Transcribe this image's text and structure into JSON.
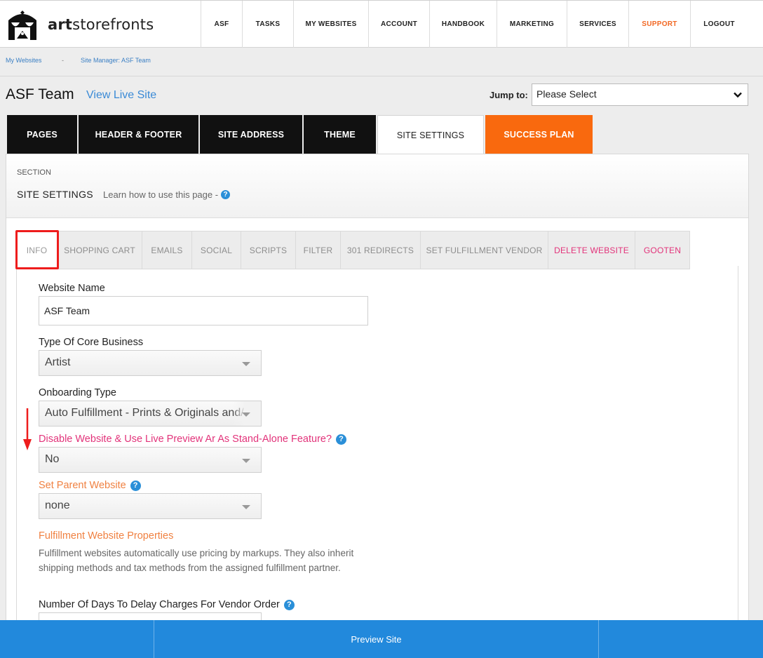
{
  "brand": {
    "name_bold": "art",
    "name_rest": "storefronts"
  },
  "nav": {
    "items": [
      {
        "label": "ASF"
      },
      {
        "label": "TASKS"
      },
      {
        "label": "MY WEBSITES"
      },
      {
        "label": "ACCOUNT"
      },
      {
        "label": "HANDBOOK"
      },
      {
        "label": "MARKETING"
      },
      {
        "label": "SERVICES"
      },
      {
        "label": "SUPPORT"
      },
      {
        "label": "LOGOUT"
      }
    ]
  },
  "breadcrumb": {
    "first": "My Websites",
    "separator": "-",
    "second": "Site Manager: ASF Team"
  },
  "header": {
    "title": "ASF Team",
    "view_live": "View Live Site",
    "jump_label": "Jump to:",
    "jump_value": "Please Select"
  },
  "tabs": [
    {
      "label": "PAGES"
    },
    {
      "label": "HEADER & FOOTER"
    },
    {
      "label": "SITE ADDRESS"
    },
    {
      "label": "THEME"
    },
    {
      "label": "SITE SETTINGS"
    },
    {
      "label": "SUCCESS PLAN"
    }
  ],
  "section": {
    "kicker": "SECTION",
    "name": "SITE SETTINGS",
    "learn": "Learn how to use this page -"
  },
  "subtabs": [
    {
      "label": "INFO"
    },
    {
      "label": "SHOPPING CART"
    },
    {
      "label": "EMAILS"
    },
    {
      "label": "SOCIAL"
    },
    {
      "label": "SCRIPTS"
    },
    {
      "label": "FILTER"
    },
    {
      "label": "301 REDIRECTS"
    },
    {
      "label": "SET FULFILLMENT VENDOR"
    },
    {
      "label": "DELETE WEBSITE"
    },
    {
      "label": "GOOTEN"
    }
  ],
  "form": {
    "website_name_label": "Website Name",
    "website_name_value": "ASF Team",
    "core_business_label": "Type Of Core Business",
    "core_business_value": "Artist",
    "onboarding_label": "Onboarding Type",
    "onboarding_value": "Auto Fulfillment - Prints & Originals and/",
    "disable_label": "Disable Website & Use Live Preview Ar As Stand-Alone Feature?",
    "disable_value": "No",
    "parent_label": "Set Parent Website",
    "parent_value": "none",
    "fulfillment_title": "Fulfillment Website Properties",
    "fulfillment_desc": "Fulfillment websites automatically use pricing by markups. They also inherit shipping methods and tax methods from the assigned fulfillment partner.",
    "delay_label": "Number Of Days To Delay Charges For Vendor Order"
  },
  "footer": {
    "preview": "Preview Site"
  },
  "colors": {
    "accent_orange": "#f9690e",
    "link_blue": "#3a8ad6",
    "pink": "#e2337a",
    "bottom_bar": "#2289dc"
  }
}
